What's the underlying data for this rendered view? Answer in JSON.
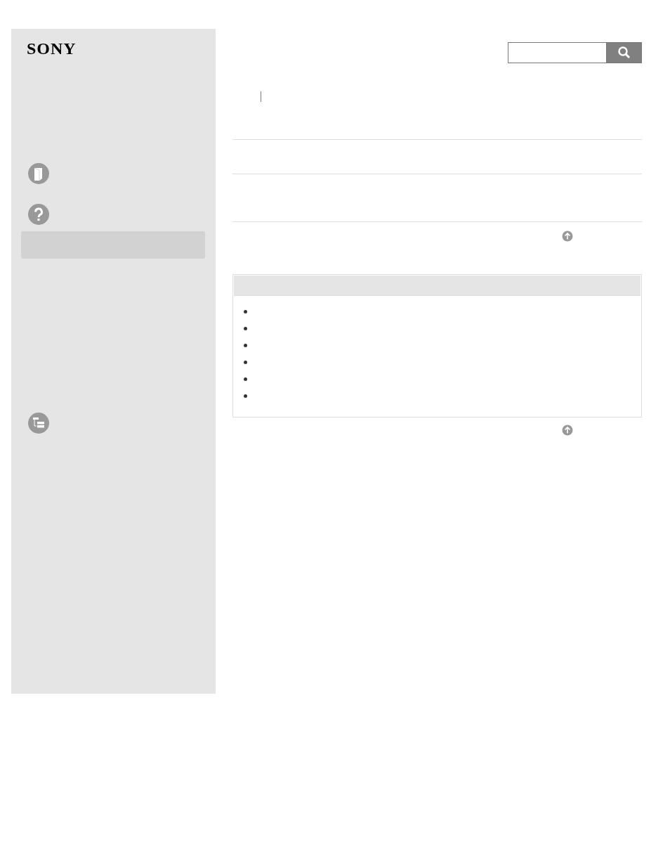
{
  "logo": {
    "text": "SONY"
  },
  "sidebar": {
    "items": [
      {
        "kind": "book"
      },
      {
        "kind": "help"
      },
      {
        "kind": "bar",
        "selected": true
      },
      {
        "kind": "tree"
      }
    ]
  },
  "content": {
    "sections": [
      {
        "kind": "rule"
      },
      {
        "kind": "rule"
      },
      {
        "kind": "rule"
      }
    ],
    "note_box": {
      "bullets": [
        {
          "kind": "bullet"
        },
        {
          "kind": "bullet"
        },
        {
          "kind": "bullet"
        },
        {
          "kind": "bullet"
        },
        {
          "kind": "bullet"
        },
        {
          "kind": "bullet"
        }
      ]
    }
  }
}
